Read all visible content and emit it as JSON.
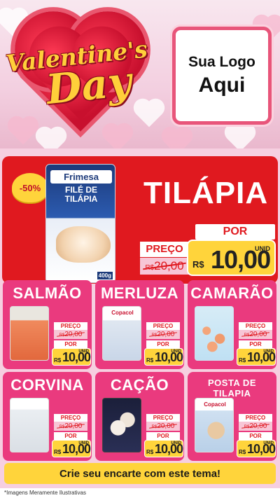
{
  "header": {
    "title_line1": "Valentine's",
    "title_line2": "Day",
    "logo_line1": "Sua Logo",
    "logo_line2": "Aqui"
  },
  "hero": {
    "discount": "-50%",
    "product": "TILÁPIA",
    "pack_brand": "Frimesa",
    "pack_name": "FILÉ DE TILÁPIA",
    "pack_weight": "400g",
    "preco_label": "PREÇO",
    "old_currency": "R$",
    "old_price": "20,00",
    "por_label": "POR",
    "new_currency": "R$",
    "new_price": "10,00",
    "unit": "UNID"
  },
  "cards": [
    {
      "title": "SALMÃO",
      "pack_label": "",
      "preco": "PREÇO",
      "old_cur": "R$",
      "old": "20,00",
      "por": "POR",
      "new_cur": "R$",
      "new": "10,00",
      "unit": "UNID"
    },
    {
      "title": "MERLUZA",
      "pack_label": "Copacol",
      "preco": "PREÇO",
      "old_cur": "R$",
      "old": "20,00",
      "por": "POR",
      "new_cur": "R$",
      "new": "10,00",
      "unit": "UNID"
    },
    {
      "title": "CAMARÃO",
      "pack_label": "",
      "preco": "PREÇO",
      "old_cur": "R$",
      "old": "20,00",
      "por": "POR",
      "new_cur": "R$",
      "new": "10,00",
      "unit": "UNID"
    },
    {
      "title": "CORVINA",
      "pack_label": "",
      "preco": "PREÇO",
      "old_cur": "R$",
      "old": "20,00",
      "por": "POR",
      "new_cur": "R$",
      "new": "10,00",
      "unit": "UNID"
    },
    {
      "title": "CAÇÃO",
      "pack_label": "",
      "preco": "PREÇO",
      "old_cur": "R$",
      "old": "20,00",
      "por": "POR",
      "new_cur": "R$",
      "new": "10,00",
      "unit": "UNID"
    },
    {
      "title": "POSTA DE TILAPIA",
      "pack_label": "Copacol",
      "preco": "PREÇO",
      "old_cur": "R$",
      "old": "20,00",
      "por": "POR",
      "new_cur": "R$",
      "new": "10,00",
      "unit": "UNID"
    }
  ],
  "cta": "Crie seu encarte com este tema!",
  "footer": "*Imagens Meramente Ilustrativas",
  "colors": {
    "hero_red": "#e0191f",
    "card_pink": "#ea3a7e",
    "price_yellow": "#ffd43b",
    "background_pink": "#f6cfe0"
  }
}
